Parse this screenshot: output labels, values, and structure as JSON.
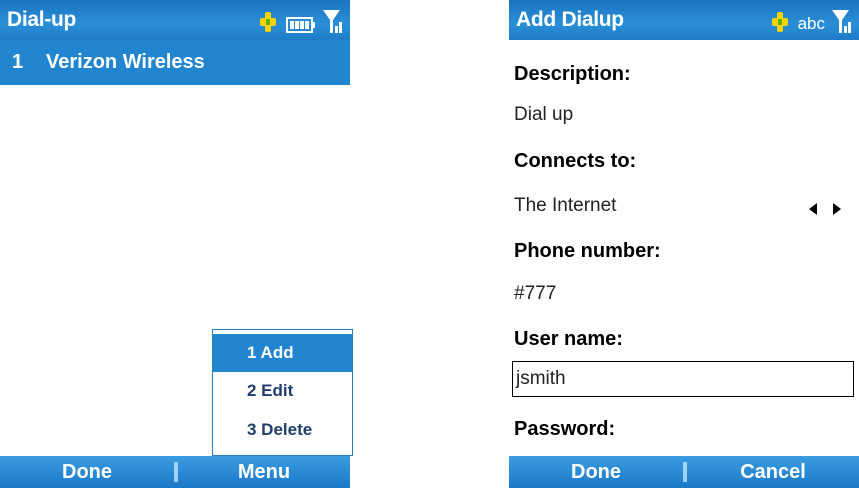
{
  "left_screen": {
    "title": "Dial-up",
    "selected_row": {
      "number": "1",
      "label": "Verizon Wireless"
    },
    "menu": [
      {
        "label": "1 Add",
        "active": true
      },
      {
        "label": "2 Edit",
        "active": false
      },
      {
        "label": "3 Delete",
        "active": false
      }
    ],
    "softkeys": {
      "left": "Done",
      "right": "Menu"
    },
    "status_icons": [
      "data-connection-icon",
      "battery-icon",
      "signal-icon"
    ]
  },
  "right_screen": {
    "title": "Add Dialup",
    "input_mode": "abc",
    "fields": {
      "description_label": "Description:",
      "description_value": "Dial up",
      "connects_label": "Connects to:",
      "connects_value": "The Internet",
      "phone_label": "Phone number:",
      "phone_value": "#777",
      "username_label": "User name:",
      "username_value": "jsmith",
      "password_label": "Password:"
    },
    "softkeys": {
      "left": "Done",
      "right": "Cancel"
    },
    "status_icons": [
      "data-connection-icon",
      "signal-icon"
    ]
  },
  "colors": {
    "title_bar": "#1e7cc8",
    "selection": "#2185d0",
    "menu_text": "#1f3f6a",
    "softkey_separator": "#9fd2f4"
  }
}
